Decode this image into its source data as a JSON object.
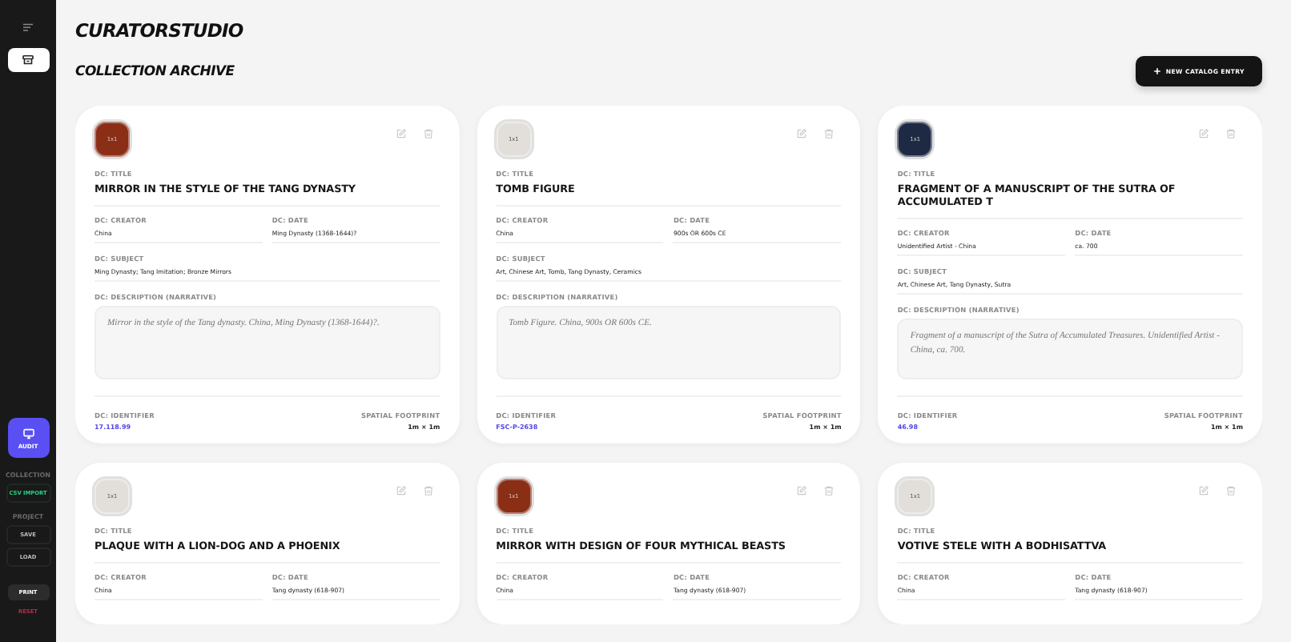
{
  "sidebar": {
    "nav_buttons": [
      {
        "kind": "menu",
        "selected": false
      },
      {
        "kind": "archive",
        "selected": true
      }
    ],
    "audit_button": "AUDIT",
    "sections": [
      {
        "heading": "COLLECTION",
        "items": [
          {
            "label": "CSV IMPORT",
            "kind": "import"
          }
        ]
      },
      {
        "heading": "PROJECT",
        "items": [
          {
            "label": "SAVE",
            "kind": "plain"
          },
          {
            "label": "LOAD",
            "kind": "plain"
          }
        ]
      }
    ],
    "print_button": "PRINT",
    "reset_button": "RESET"
  },
  "header": {
    "app_title": "CURATORSTUDIO",
    "page_title": "COLLECTION ARCHIVE",
    "new_entry_button": "NEW CATALOG ENTRY"
  },
  "cards": [
    {
      "color": "#8b2e16",
      "swatch_label": "1x1",
      "title_label": "DC: TITLE",
      "title": "MIRROR IN THE STYLE OF THE TANG DYNASTY",
      "creator_label": "DC: CREATOR",
      "creator": "China",
      "date_label": "DC: DATE",
      "date": "Ming Dynasty (1368-1644)?",
      "subject_label": "DC: SUBJECT",
      "subject": "Ming Dynasty; Tang Imitation; Bronze Mirrors",
      "description_label": "DC: DESCRIPTION (NARRATIVE)",
      "description": "Mirror in the style of the Tang dynasty. China, Ming Dynasty (1368-1644)?.",
      "identifier_label": "DC: IDENTIFIER",
      "identifier": "17.118.99",
      "footprint_label": "SPATIAL FOOTPRINT",
      "footprint": "1m × 1m"
    },
    {
      "color": "#e2dfdb",
      "swatch_label": "1x1",
      "title_label": "DC: TITLE",
      "title": "TOMB FIGURE",
      "creator_label": "DC: CREATOR",
      "creator": "China",
      "date_label": "DC: DATE",
      "date": "900s OR 600s CE",
      "subject_label": "DC: SUBJECT",
      "subject": "Art, Chinese Art, Tomb, Tang Dynasty, Ceramics",
      "description_label": "DC: DESCRIPTION (NARRATIVE)",
      "description": "Tomb Figure. China, 900s OR 600s CE.",
      "identifier_label": "DC: IDENTIFIER",
      "identifier": "FSC-P-2638",
      "footprint_label": "SPATIAL FOOTPRINT",
      "footprint": "1m × 1m"
    },
    {
      "color": "#1e2a44",
      "swatch_label": "1x1",
      "title_label": "DC: TITLE",
      "title": "FRAGMENT OF A MANUSCRIPT OF THE SUTRA OF ACCUMULATED T",
      "creator_label": "DC: CREATOR",
      "creator": "Unidentified Artist - China",
      "date_label": "DC: DATE",
      "date": "ca. 700",
      "subject_label": "DC: SUBJECT",
      "subject": "Art, Chinese Art, Tang Dynasty, Sutra",
      "description_label": "DC: DESCRIPTION (NARRATIVE)",
      "description": "Fragment of a manuscript of the Sutra of Accumulated Treasures. Unidentified Artist - China, ca. 700.",
      "identifier_label": "DC: IDENTIFIER",
      "identifier": "46.98",
      "footprint_label": "SPATIAL FOOTPRINT",
      "footprint": "1m × 1m"
    },
    {
      "color": "#e2dfdb",
      "swatch_label": "1x1",
      "title_label": "DC: TITLE",
      "title": "PLAQUE WITH A LION-DOG AND A PHOENIX",
      "creator_label": "DC: CREATOR",
      "creator": "China",
      "date_label": "DC: DATE",
      "date": "Tang dynasty (618-907)"
    },
    {
      "color": "#8b2e16",
      "swatch_label": "1x1",
      "title_label": "DC: TITLE",
      "title": "MIRROR WITH DESIGN OF FOUR MYTHICAL BEASTS",
      "creator_label": "DC: CREATOR",
      "creator": "China",
      "date_label": "DC: DATE",
      "date": "Tang dynasty (618-907)"
    },
    {
      "color": "#e2dfdb",
      "swatch_label": "1x1",
      "title_label": "DC: TITLE",
      "title": "VOTIVE STELE WITH A BODHISATTVA",
      "creator_label": "DC: CREATOR",
      "creator": "China",
      "date_label": "DC: DATE",
      "date": "Tang dynasty (618-907)"
    }
  ]
}
